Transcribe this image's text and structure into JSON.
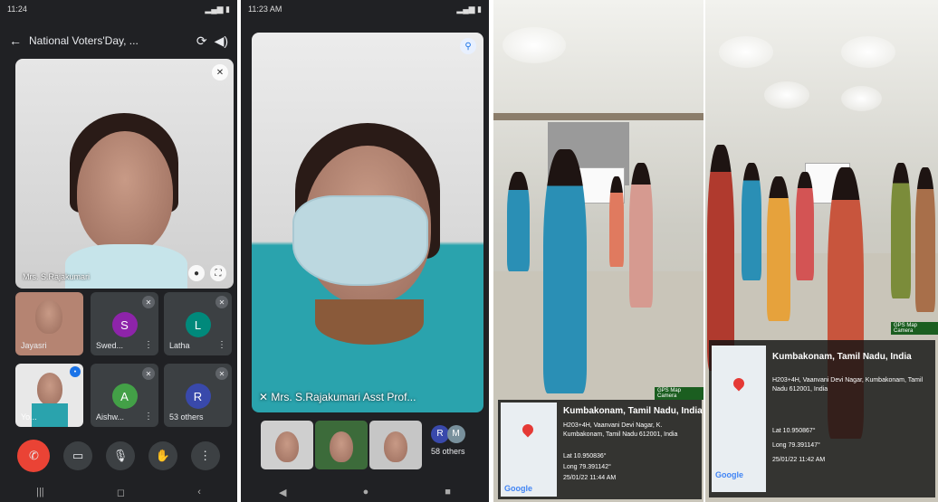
{
  "panel1": {
    "status_time": "11:24",
    "call_title": "National Voters'Day, ...",
    "speaker_name": "Mrs. S.Rajakumari",
    "tiles": [
      {
        "label": "Jayasri"
      },
      {
        "label": "Swed...",
        "initial": "S",
        "color": "#8e24aa"
      },
      {
        "label": "Latha",
        "initial": "L",
        "color": "#00897b"
      },
      {
        "label": "Yo..."
      },
      {
        "label": "Aishw...",
        "initial": "A",
        "color": "#43a047"
      },
      {
        "label": "53 others",
        "initial": "R",
        "color": "#3949ab"
      }
    ],
    "icons": {
      "back": "back-arrow-icon",
      "camera_switch": "switch-camera-icon",
      "volume": "volume-icon"
    }
  },
  "panel2": {
    "status_time": "11:23 AM",
    "spotlight_name": "Mrs. S.Rajakumari Asst Prof...",
    "others_label": "58 others",
    "others_initials": [
      "R",
      "M"
    ]
  },
  "photo1": {
    "location": "Kumbakonam, Tamil Nadu, India",
    "address": "H203+4H, Vaanvani Devi Nagar, K. Kumbakonam, Tamil Nadu 612001, India",
    "lat": "Lat 10.950836°",
    "long": "Long 79.391142°",
    "date": "25/01/22 11:44 AM",
    "logo": "Google",
    "stamp": "GPS Map Camera"
  },
  "photo2": {
    "location": "Kumbakonam, Tamil Nadu, India",
    "address": "H203+4H, Vaanvani Devi Nagar, Kumbakonam, Tamil Nadu 612001, India",
    "lat": "Lat 10.950867°",
    "long": "Long 79.391147°",
    "date": "25/01/22 11:42 AM",
    "logo": "Google",
    "stamp": "GPS Map Camera"
  }
}
